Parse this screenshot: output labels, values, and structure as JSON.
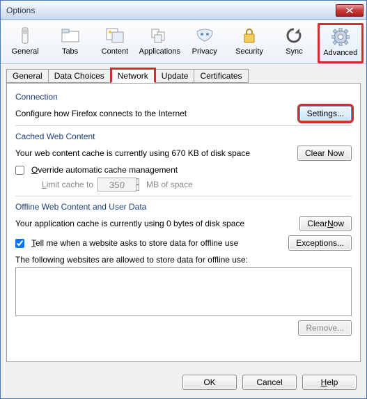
{
  "window": {
    "title": "Options"
  },
  "toolbar": {
    "items": [
      {
        "label": "General"
      },
      {
        "label": "Tabs"
      },
      {
        "label": "Content"
      },
      {
        "label": "Applications"
      },
      {
        "label": "Privacy"
      },
      {
        "label": "Security"
      },
      {
        "label": "Sync"
      },
      {
        "label": "Advanced"
      }
    ]
  },
  "subtabs": {
    "general": "General",
    "data_choices": "Data Choices",
    "network": "Network",
    "update": "Update",
    "certificates": "Certificates"
  },
  "connection": {
    "heading": "Connection",
    "description": "Configure how Firefox connects to the Internet",
    "settings_btn": "Settings..."
  },
  "cache": {
    "heading": "Cached Web Content",
    "usage_text": "Your web content cache is currently using 670 KB of disk space",
    "clear_btn": "Clear Now",
    "override_label_prefix": "O",
    "override_label_rest": "verride automatic cache management",
    "limit_label_prefix": "L",
    "limit_label_rest": "imit cache to",
    "limit_value": "350",
    "limit_unit": "MB of space"
  },
  "offline": {
    "heading": "Offline Web Content and User Data",
    "usage_text": "Your application cache is currently using 0 bytes of disk space",
    "clear_btn": "Clear Now",
    "tell_prefix": "T",
    "tell_rest": "ell me when a website asks to store data for offline use",
    "exceptions_btn": "Exceptions...",
    "allowed_text": "The following websites are allowed to store data for offline use:",
    "remove_btn": "Remove..."
  },
  "footer": {
    "ok": "OK",
    "cancel": "Cancel",
    "help": "Help"
  }
}
